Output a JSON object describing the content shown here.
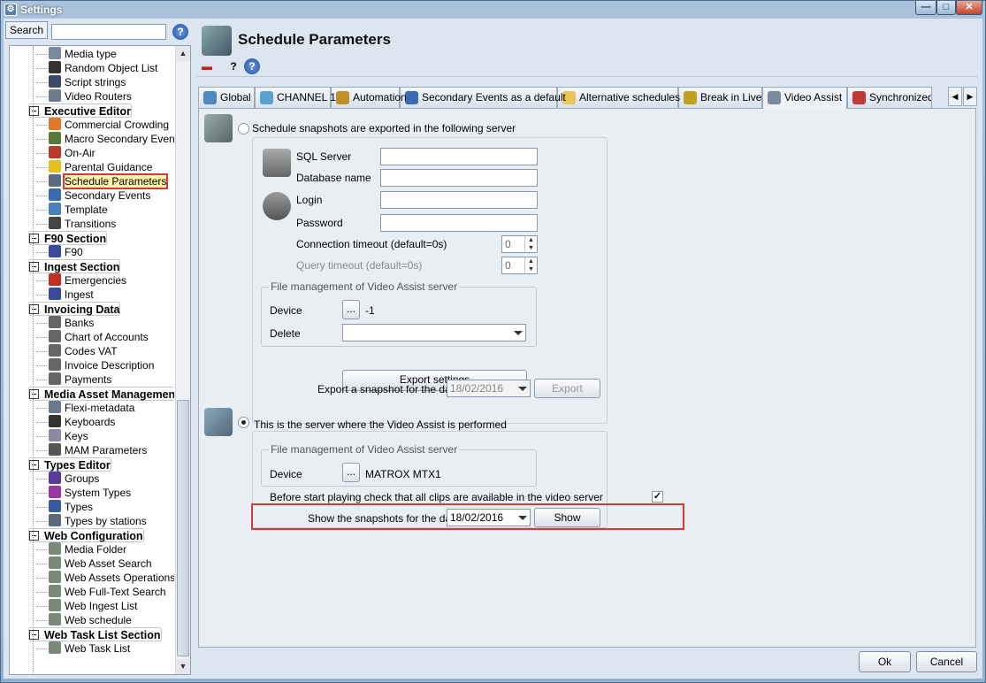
{
  "window": {
    "title": "Settings",
    "minimize": "—",
    "maximize": "□",
    "close": "✕"
  },
  "search": {
    "label": "Search",
    "value": "",
    "help_glyph": "?"
  },
  "tree": [
    {
      "type": "item",
      "label": "Media type",
      "icon": "media-type-icon",
      "color": "#7a8aa0"
    },
    {
      "type": "item",
      "label": "Random Object List",
      "icon": "random-object-icon",
      "color": "#333333"
    },
    {
      "type": "item",
      "label": "Script strings",
      "icon": "script-icon",
      "color": "#3b4a6b"
    },
    {
      "type": "item",
      "label": "Video Routers",
      "icon": "router-icon",
      "color": "#6d7b8c"
    },
    {
      "type": "group",
      "label": "Executive Editor"
    },
    {
      "type": "item",
      "label": "Commercial Crowding",
      "icon": "hand-icon",
      "color": "#e07a2a"
    },
    {
      "type": "item",
      "label": "Macro Secondary Events",
      "icon": "macro-icon",
      "color": "#5a7a3a"
    },
    {
      "type": "item",
      "label": "On-Air",
      "icon": "onair-icon",
      "color": "#b83a2a"
    },
    {
      "type": "item",
      "label": "Parental Guidance",
      "icon": "warning-icon",
      "color": "#e8c020"
    },
    {
      "type": "item",
      "label": "Schedule Parameters",
      "icon": "clapper-icon",
      "color": "#5a6b80",
      "selected": true
    },
    {
      "type": "item",
      "label": "Secondary Events",
      "icon": "secondary-events-icon",
      "color": "#3a6ab0"
    },
    {
      "type": "item",
      "label": "Template",
      "icon": "template-icon",
      "color": "#4a80c0"
    },
    {
      "type": "item",
      "label": "Transitions",
      "icon": "transitions-icon",
      "color": "#444444"
    },
    {
      "type": "group",
      "label": "F90 Section"
    },
    {
      "type": "item",
      "label": "F90",
      "icon": "f90-icon",
      "color": "#3a4a9a"
    },
    {
      "type": "group",
      "label": "Ingest Section"
    },
    {
      "type": "item",
      "label": "Emergencies",
      "icon": "emergency-icon",
      "color": "#c03020"
    },
    {
      "type": "item",
      "label": "Ingest",
      "icon": "ingest-icon",
      "color": "#3a4a9a"
    },
    {
      "type": "group",
      "label": "Invoicing Data"
    },
    {
      "type": "item",
      "label": "Banks",
      "icon": "document-icon",
      "color": "#666666"
    },
    {
      "type": "item",
      "label": "Chart of Accounts",
      "icon": "document-icon",
      "color": "#666666"
    },
    {
      "type": "item",
      "label": "Codes VAT",
      "icon": "document-icon",
      "color": "#666666"
    },
    {
      "type": "item",
      "label": "Invoice Description",
      "icon": "document-icon",
      "color": "#666666"
    },
    {
      "type": "item",
      "label": "Payments",
      "icon": "document-icon",
      "color": "#666666"
    },
    {
      "type": "group",
      "label": "Media Asset Management"
    },
    {
      "type": "item",
      "label": "Flexi-metadata",
      "icon": "flexi-icon",
      "color": "#6a7a8a"
    },
    {
      "type": "item",
      "label": "Keyboards",
      "icon": "keyboard-icon",
      "color": "#333333"
    },
    {
      "type": "item",
      "label": "Keys",
      "icon": "keys-icon",
      "color": "#8a8aa0"
    },
    {
      "type": "item",
      "label": "MAM Parameters",
      "icon": "mam-icon",
      "color": "#555555"
    },
    {
      "type": "group",
      "label": "Types Editor"
    },
    {
      "type": "item",
      "label": "Groups",
      "icon": "groups-icon",
      "color": "#5a3a9a"
    },
    {
      "type": "item",
      "label": "System Types",
      "icon": "system-types-icon",
      "color": "#9a3aa0"
    },
    {
      "type": "item",
      "label": "Types",
      "icon": "types-icon",
      "color": "#3a5aa0"
    },
    {
      "type": "item",
      "label": "Types by stations",
      "icon": "types-stations-icon",
      "color": "#5a6a7a"
    },
    {
      "type": "group",
      "label": "Web Configuration"
    },
    {
      "type": "item",
      "label": "Media Folder",
      "icon": "web-icon",
      "color": "#7a8a7a"
    },
    {
      "type": "item",
      "label": "Web Asset Search",
      "icon": "web-icon",
      "color": "#7a8a7a"
    },
    {
      "type": "item",
      "label": "Web Assets Operations",
      "icon": "web-icon",
      "color": "#7a8a7a"
    },
    {
      "type": "item",
      "label": "Web Full-Text Search",
      "icon": "web-icon",
      "color": "#7a8a7a"
    },
    {
      "type": "item",
      "label": "Web Ingest List",
      "icon": "web-icon",
      "color": "#7a8a7a"
    },
    {
      "type": "item",
      "label": "Web schedule",
      "icon": "web-icon",
      "color": "#7a8a7a"
    },
    {
      "type": "group",
      "label": "Web Task List Section"
    },
    {
      "type": "item",
      "label": "Web Task List",
      "icon": "web-icon",
      "color": "#7a8a7a"
    }
  ],
  "header": {
    "title": "Schedule Parameters"
  },
  "toolbar": {
    "delete_glyph": "▬",
    "help_cursor_glyph": "?",
    "help_glyph": "?"
  },
  "tabs": [
    {
      "label": "Global",
      "icon": "globe-icon",
      "color": "#4a8ac0"
    },
    {
      "label": "CHANNEL 1",
      "icon": "channel-icon",
      "color": "#5aa0d0"
    },
    {
      "label": "Automation",
      "icon": "automation-icon",
      "color": "#c0902a"
    },
    {
      "label": "Secondary Events as a default",
      "icon": "secondary-events-icon",
      "color": "#3a6ab0"
    },
    {
      "label": "Alternative schedules",
      "icon": "folder-icon",
      "color": "#e8c45a"
    },
    {
      "label": "Break in Live",
      "icon": "break-icon",
      "color": "#c0a020"
    },
    {
      "label": "Video Assist",
      "icon": "video-assist-icon",
      "color": "#7a8a9a",
      "active": true
    },
    {
      "label": "Synchronized pl",
      "icon": "sync-icon",
      "color": "#c03a3a"
    }
  ],
  "tabnav": {
    "left": "◀",
    "right": "▶"
  },
  "export_section": {
    "radio_label": "Schedule snapshots are exported in the following server",
    "sql_server_label": "SQL Server",
    "database_label": "Database name",
    "login_label": "Login",
    "password_label": "Password",
    "sql_server_value": "",
    "database_value": "",
    "login_value": "",
    "password_value": "",
    "conn_timeout_label": "Connection timeout (default=0s)",
    "conn_timeout_value": "0",
    "query_timeout_label": "Query timeout (default=0s)",
    "query_timeout_value": "0",
    "spin_up": "▲",
    "spin_down": "▼",
    "fm_title": "File management of Video Assist server",
    "device_label": "Device",
    "device_btn": "...",
    "device_value": "-1",
    "delete_label": "Delete",
    "delete_value": "",
    "export_settings_btn": "Export settings",
    "export_day_label": "Export a snapshot for the day",
    "export_day_value": "18/02/2016",
    "export_btn": "Export"
  },
  "local_section": {
    "radio_label": "This is the server where the Video Assist is performed",
    "fm_title": "File management of Video Assist server",
    "device_label": "Device",
    "device_btn": "...",
    "device_value": "MATROX MTX1",
    "check_label": "Before start playing check that all clips are available in the video server",
    "check_glyph": "✓",
    "check_value": true,
    "show_day_label": "Show the snapshots for the day",
    "show_day_value": "18/02/2016",
    "show_btn": "Show"
  },
  "footer": {
    "ok": "Ok",
    "cancel": "Cancel"
  }
}
